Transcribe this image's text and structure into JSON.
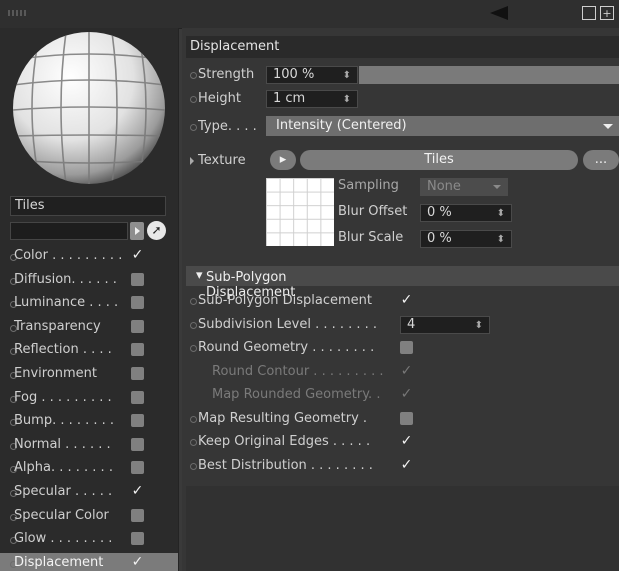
{
  "left": {
    "material_name": "Tiles",
    "channels": [
      {
        "label": "Color . . . . . . . . .",
        "checked": true
      },
      {
        "label": "Diffusion. . . . . .",
        "checked": false
      },
      {
        "label": "Luminance . . . .",
        "checked": false
      },
      {
        "label": "Transparency",
        "checked": false
      },
      {
        "label": "Reflection . . . .",
        "checked": false
      },
      {
        "label": "Environment",
        "checked": false
      },
      {
        "label": "Fog . . . . . . . . .",
        "checked": false
      },
      {
        "label": "Bump. . . . . . . .",
        "checked": false
      },
      {
        "label": "Normal . . . . . .",
        "checked": false
      },
      {
        "label": "Alpha. . . . . . . .",
        "checked": false
      },
      {
        "label": "Specular . . . . .",
        "checked": true
      },
      {
        "label": "Specular Color",
        "checked": false
      },
      {
        "label": "Glow . . . . . . . .",
        "checked": false
      },
      {
        "label": "Displacement",
        "checked": true
      }
    ]
  },
  "displacement": {
    "section_title": "Displacement",
    "strength_label": "Strength",
    "strength_value": "100 %",
    "strength_fraction": 1.0,
    "height_label": "Height",
    "height_value": "1 cm",
    "type_label": "Type. . . .",
    "type_value": "Intensity (Centered)",
    "texture_label": "Texture",
    "texture_name": "Tiles",
    "texture_more": "...",
    "sampling_label": "Sampling",
    "sampling_value": "None",
    "blur_offset_label": "Blur Offset",
    "blur_offset_value": "0 %",
    "blur_scale_label": "Blur Scale",
    "blur_scale_value": "0 %"
  },
  "subpoly": {
    "title": "Sub-Polygon Displacement",
    "rows": [
      {
        "label": "Sub-Polygon Displacement",
        "checked": true,
        "enabled": true
      },
      {
        "label": "Subdivision Level . . . . . . . .",
        "value": "4",
        "enabled": true
      },
      {
        "label": "Round Geometry . . . . . . . .",
        "checked": false,
        "enabled": true
      },
      {
        "label": "Round Contour . . . . . . . . .",
        "checked": true,
        "enabled": false
      },
      {
        "label": "Map Rounded Geometry. .",
        "checked": true,
        "enabled": false
      },
      {
        "label": "Map Resulting Geometry .",
        "checked": false,
        "enabled": true
      },
      {
        "label": "Keep Original Edges . . . . .",
        "checked": true,
        "enabled": true
      },
      {
        "label": "Best Distribution . . . . . . . .",
        "checked": true,
        "enabled": true
      }
    ]
  },
  "colors": {
    "panel_bg": "#363636",
    "left_bg": "#2b2b2b",
    "selected_channel": "#7b7b7b",
    "dropdown_bg": "#6e6e6e"
  }
}
